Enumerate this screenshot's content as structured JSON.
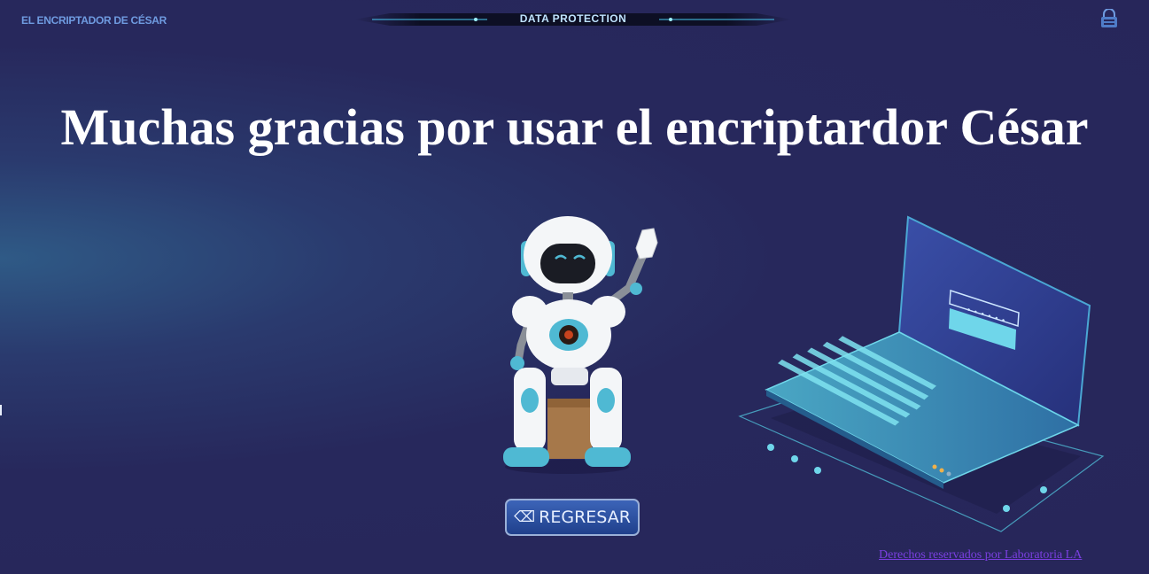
{
  "header": {
    "brand": "EL ENCRIPTADOR DE CÉSAR",
    "banner": "DATA PROTECTION",
    "logo_icon": "lock-shield-icon"
  },
  "main": {
    "title": "Muchas gracias por usar el encriptardor César",
    "robot_image": "waving-robot-illustration",
    "laptop_image": "laptop-password-illustration",
    "back_button": {
      "icon": "⌫",
      "label": "REGRESAR"
    }
  },
  "footer": {
    "link_text": "Derechos reservados por Laboratoria LA"
  },
  "colors": {
    "background": "#27265a",
    "accent": "#5cc6da",
    "button": "#2a4fa3",
    "footer_link": "#7a3fe0"
  }
}
